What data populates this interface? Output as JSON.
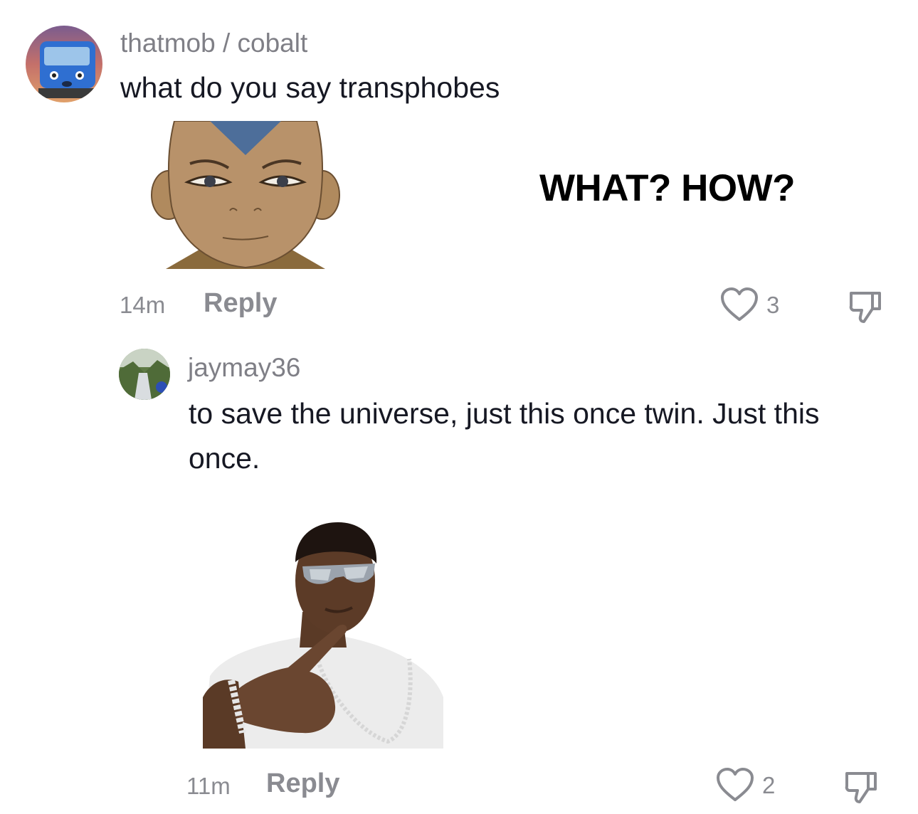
{
  "comments": [
    {
      "username": "thatmob / cobalt",
      "text": "what do you say transphobes",
      "sticker_caption": "WHAT? HOW?",
      "time": "14m",
      "reply_label": "Reply",
      "likes": "3"
    },
    {
      "username": "jaymay36",
      "text": "to save the universe, just this once twin. Just this once.",
      "time": "11m",
      "reply_label": "Reply",
      "likes": "2"
    }
  ],
  "icons": {
    "like": "heart-outline-icon",
    "dislike": "thumbs-down-icon"
  },
  "colors": {
    "text_primary": "#161823",
    "text_secondary": "#8a8b91",
    "background": "#ffffff"
  }
}
